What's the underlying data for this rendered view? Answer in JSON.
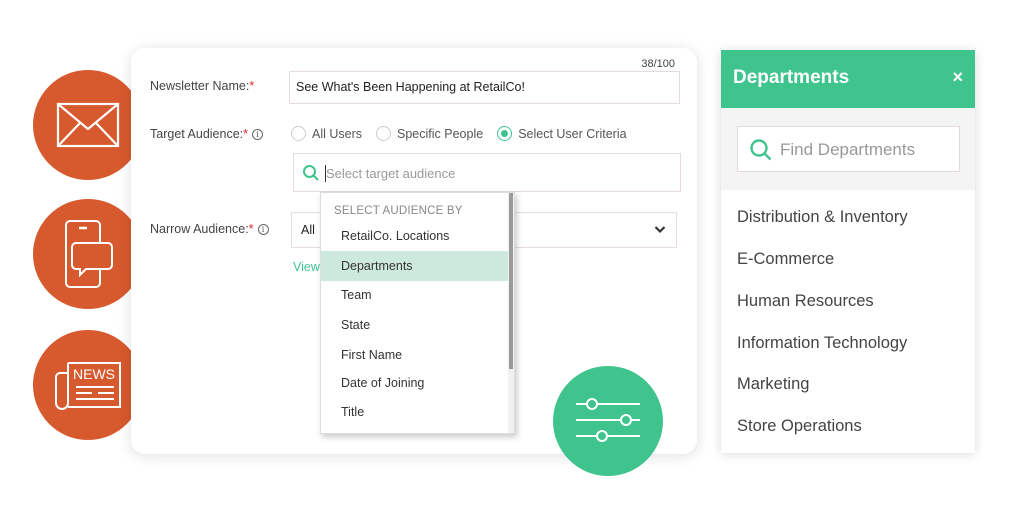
{
  "form": {
    "char_count": "38/100",
    "newsletter_name": {
      "label": "Newsletter Name:",
      "required_mark": "*",
      "value": "See What's Been Happening at RetailCo!"
    },
    "target_audience": {
      "label": "Target Audience:",
      "required_mark": "*",
      "info_icon": "i",
      "options": [
        {
          "label": "All Users",
          "checked": false
        },
        {
          "label": "Specific People",
          "checked": false
        },
        {
          "label": "Select User Criteria",
          "checked": true
        }
      ],
      "search_placeholder": "Select target audience"
    },
    "narrow_audience": {
      "label": "Narrow Audience:",
      "required_mark": "*",
      "info_icon": "i",
      "selected_value": "All",
      "view_link": "View"
    },
    "dropdown": {
      "header": "SELECT AUDIENCE BY",
      "options": [
        {
          "label": "RetailCo. Locations",
          "active": false
        },
        {
          "label": "Departments",
          "active": true
        },
        {
          "label": "Team",
          "active": false
        },
        {
          "label": "State",
          "active": false
        },
        {
          "label": "First Name",
          "active": false
        },
        {
          "label": "Date of Joining",
          "active": false
        },
        {
          "label": "Title",
          "active": false
        }
      ]
    }
  },
  "side_icons": [
    {
      "name": "envelope-icon",
      "color": "#d7592e"
    },
    {
      "name": "mobile-chat-icon",
      "color": "#d7592e"
    },
    {
      "name": "newspaper-icon",
      "color": "#d7592e",
      "text": "NEWS"
    }
  ],
  "filter_icon": {
    "name": "sliders-icon",
    "color": "#3fc48e"
  },
  "departments_panel": {
    "title": "Departments",
    "close_label": "×",
    "search_placeholder": "Find Departments",
    "items": [
      "Distribution & Inventory",
      "E-Commerce",
      "Human Resources",
      "Information Technology",
      "Marketing",
      "Store Operations"
    ]
  },
  "colors": {
    "accent_green": "#3fc48e",
    "accent_orange": "#d7592e",
    "active_row": "#cde9dd",
    "required_red": "#e0262e"
  }
}
